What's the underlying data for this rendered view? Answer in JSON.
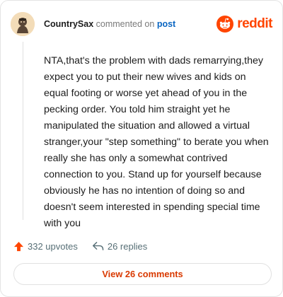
{
  "header": {
    "username": "CountrySax",
    "action_text": "commented on",
    "post_link": "post",
    "brand_name": "reddit",
    "brand_color": "#ff4500"
  },
  "comment": {
    "text": "NTA,that's the problem with dads remarrying,they expect you to put their new wives and kids on equal footing or worse yet ahead of you in the pecking order. You told him straight yet he manipulated the situation and allowed a virtual stranger,your \"step something\" to berate you when really she has only a somewhat contrived connection to you. Stand up for yourself because obviously he has no intention of doing so and doesn't seem interested in spending special time with you"
  },
  "actions": {
    "upvotes_label": "332 upvotes",
    "replies_label": "26 replies",
    "upvote_icon": "upvote-arrow-icon",
    "reply_icon": "reply-arrow-icon"
  },
  "footer": {
    "view_comments_label": "View 26 comments",
    "accent_color": "#d93900"
  }
}
